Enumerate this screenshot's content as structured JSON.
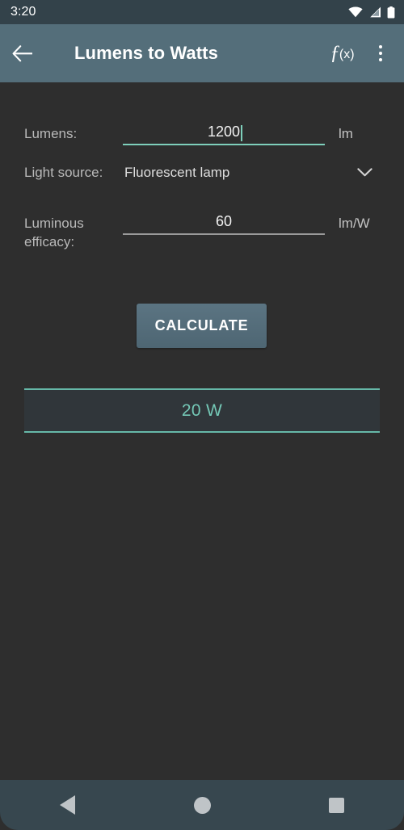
{
  "status_bar": {
    "clock": "3:20",
    "icons": [
      "wifi-icon",
      "cell-signal-icon",
      "battery-icon"
    ]
  },
  "app_bar": {
    "back_icon": "back-arrow-icon",
    "title": "Lumens to Watts",
    "formula_icon_f": "ƒ",
    "formula_icon_x": "(x)",
    "overflow_icon": "more-vert-icon"
  },
  "form": {
    "lumens": {
      "label": "Lumens:",
      "value": "1200",
      "placeholder": "",
      "unit": "lm",
      "focused": true
    },
    "light_source": {
      "label": "Light source:",
      "value": "Fluorescent lamp",
      "dropdown_icon": "chevron-down-icon"
    },
    "luminous_efficacy": {
      "label": "Luminous efficacy:",
      "value": "60",
      "placeholder": "",
      "unit": "lm/W",
      "focused": false
    }
  },
  "calculate_button": {
    "label": "CALCULATE"
  },
  "result": {
    "value": "20 W"
  },
  "nav_bar": {
    "back": "nav-back-icon",
    "home": "nav-home-icon",
    "recents": "nav-recents-icon"
  },
  "colors": {
    "app_bar": "#546e7a",
    "status_bar": "#33424a",
    "background": "#2e2e2e",
    "accent_teal": "#74c8b6",
    "button": "#5b7482",
    "nav_bar": "#37474f"
  }
}
